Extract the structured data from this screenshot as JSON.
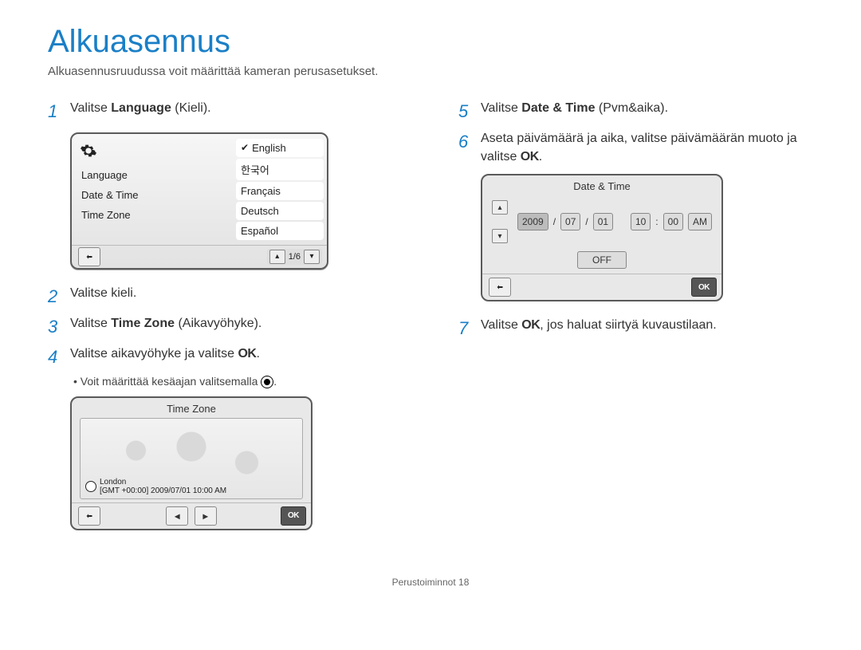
{
  "title": "Alkuasennus",
  "subtitle": "Alkuasennusruudussa voit määrittää kameran perusasetukset.",
  "steps_left": {
    "s1": {
      "num": "1",
      "pre": "Valitse ",
      "bold": "Language",
      "post": " (Kieli)."
    },
    "s2": {
      "num": "2",
      "text": "Valitse kieli."
    },
    "s3": {
      "num": "3",
      "pre": "Valitse ",
      "bold": "Time Zone",
      "post": " (Aikavyöhyke)."
    },
    "s4": {
      "num": "4",
      "pre": "Valitse aikavyöhyke ja valitse ",
      "ok": "OK",
      "post": "."
    },
    "s4_bullet": "Voit määrittää kesäajan valitsemalla "
  },
  "steps_right": {
    "s5": {
      "num": "5",
      "pre": "Valitse ",
      "bold": "Date & Time",
      "post": " (Pvm&aika)."
    },
    "s6": {
      "num": "6",
      "pre": "Aseta päivämäärä ja aika, valitse päivämäärän muoto ja valitse ",
      "ok": "OK",
      "post": "."
    },
    "s7": {
      "num": "7",
      "pre": "Valitse ",
      "ok": "OK",
      "post": ", jos haluat siirtyä kuvaustilaan."
    }
  },
  "lang_panel": {
    "menu": {
      "language": "Language",
      "datetime": "Date & Time",
      "timezone": "Time Zone"
    },
    "options": {
      "english": "English",
      "korean": "한국어",
      "francais": "Français",
      "deutsch": "Deutsch",
      "espanol": "Español"
    },
    "pager": "1/6"
  },
  "tz_panel": {
    "title": "Time Zone",
    "city": "London",
    "detail": "[GMT +00:00] 2009/07/01 10:00 AM",
    "ok": "OK"
  },
  "dt_panel": {
    "title": "Date & Time",
    "year": "2009",
    "mon": "07",
    "day": "01",
    "hour": "10",
    "min": "00",
    "ampm": "AM",
    "sep": "/",
    "colon": ":",
    "off": "OFF",
    "ok": "OK"
  },
  "footer": {
    "section": "Perustoiminnot",
    "page": "18"
  }
}
